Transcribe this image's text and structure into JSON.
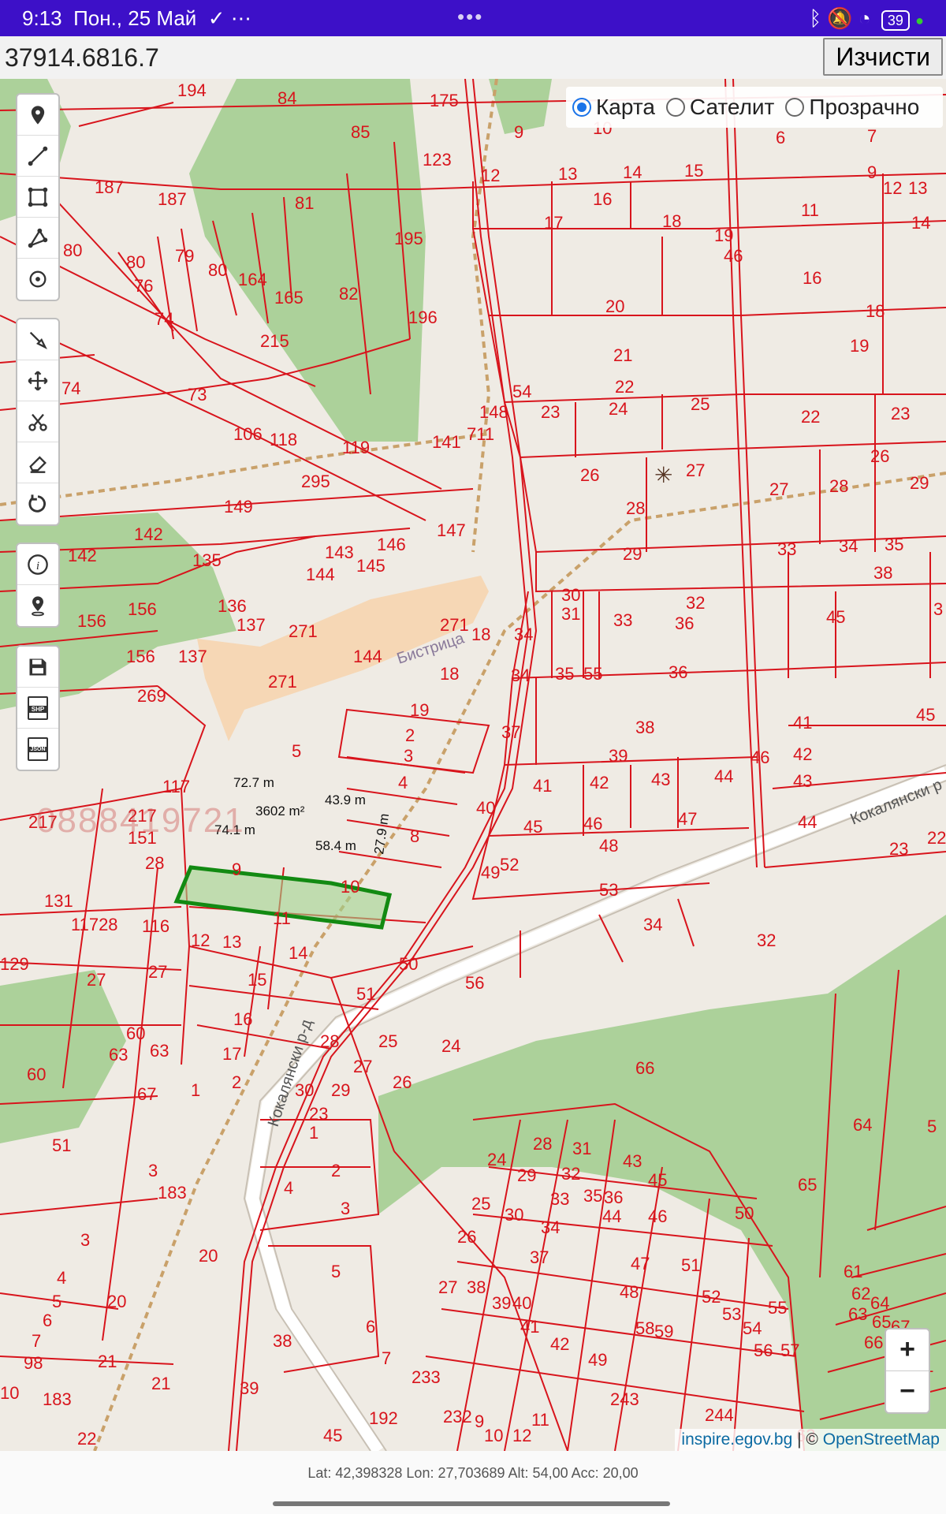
{
  "status_bar": {
    "time": "9:13",
    "date": "Пон., 25 Май",
    "battery": "39"
  },
  "search": {
    "value": "37914.6816.7",
    "clear_label": "Изчисти"
  },
  "layers": {
    "options": [
      "Карта",
      "Сателит",
      "Прозрачно"
    ],
    "selected": "Карта"
  },
  "tools": {
    "group1": [
      "marker-icon",
      "polyline-icon",
      "rectangle-icon",
      "polygon-icon",
      "circle-icon"
    ],
    "group2": [
      "edit-icon",
      "move-icon",
      "cut-icon",
      "eraser-icon",
      "rotate-icon"
    ],
    "group3": [
      "info-icon",
      "location-pin-icon"
    ],
    "group4": [
      "save-icon",
      "export-shp-icon",
      "export-json-icon"
    ],
    "shp_label": "SHP",
    "json_label": "JSON"
  },
  "map": {
    "selected_parcel": {
      "area": "3602 m²",
      "edges": [
        "72.7 m",
        "43.9 m",
        "27.9 m",
        "58.4 m",
        "74.1 m"
      ]
    },
    "street_labels": [
      "Кокалянски р",
      "Кокалянски р-д",
      "Бистрица"
    ],
    "watermark": "0888419721",
    "colors": {
      "parcel_line": "#d8141c",
      "forest": "#acd19a",
      "water": "#f6d7b5",
      "selection": "#128a12"
    }
  },
  "zoom": {
    "in": "+",
    "out": "−"
  },
  "attribution": {
    "source1": "inspire.egov.bg",
    "sep": " | © ",
    "source2": "OpenStreetMap"
  },
  "footer": {
    "coords": "Lat: 42,398328 Lon: 27,703689 Alt: 54,00 Acc: 20,00"
  }
}
